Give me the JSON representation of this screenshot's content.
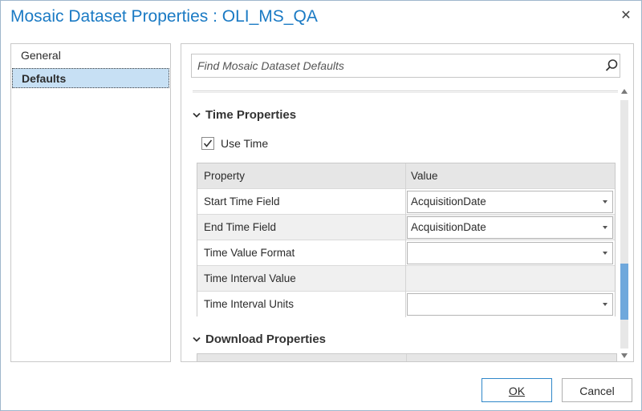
{
  "window": {
    "title": "Mosaic Dataset Properties : OLI_MS_QA",
    "close_label": "✕"
  },
  "nav": {
    "items": [
      {
        "label": "General",
        "selected": false
      },
      {
        "label": "Defaults",
        "selected": true
      }
    ]
  },
  "search": {
    "placeholder": "Find Mosaic Dataset Defaults"
  },
  "time_section": {
    "title": "Time Properties",
    "use_time_label": "Use Time",
    "use_time_checked": true,
    "columns": [
      "Property",
      "Value"
    ],
    "rows": [
      {
        "property": "Start Time Field",
        "value": "AcquisitionDate",
        "editable": true
      },
      {
        "property": "End Time Field",
        "value": "AcquisitionDate",
        "editable": true
      },
      {
        "property": "Time Value Format",
        "value": "",
        "editable": true
      },
      {
        "property": "Time Interval Value",
        "value": "",
        "editable": false
      },
      {
        "property": "Time Interval Units",
        "value": "",
        "editable": true
      }
    ]
  },
  "download_section": {
    "title": "Download Properties"
  },
  "buttons": {
    "ok": "OK",
    "cancel": "Cancel"
  },
  "colors": {
    "title_blue": "#1a7ac4",
    "selection": "#c7e0f4",
    "scroll_thumb": "#6fa8dc"
  }
}
